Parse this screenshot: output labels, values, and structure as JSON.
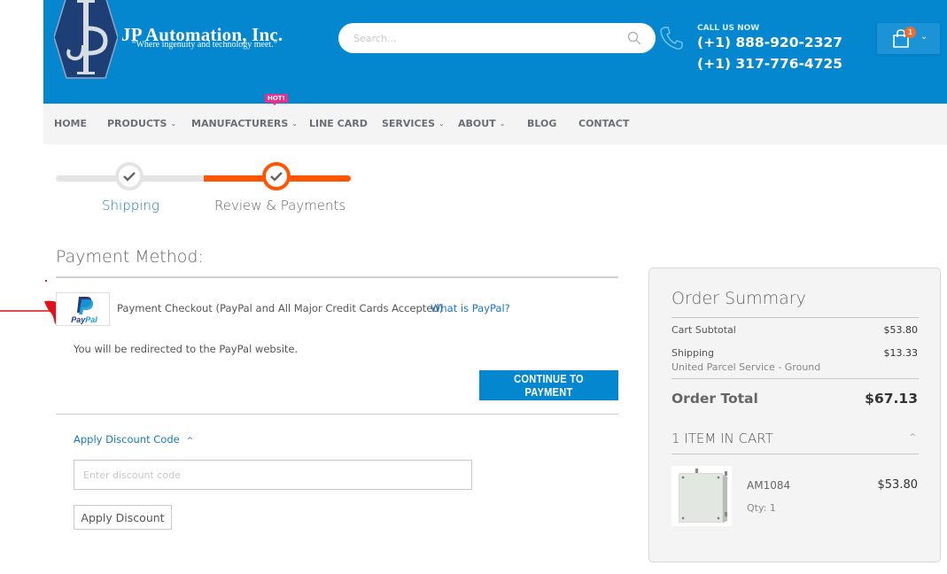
{
  "header": {
    "logo_monogram": "JP",
    "company_name": "JP Automation, Inc.",
    "tagline": "“Where ingenuity and technology meet.”",
    "search_placeholder": "Search...",
    "search_icon": "search-icon",
    "phone_icon": "phone-icon",
    "call_label": "CALL US NOW",
    "phone_primary": "(+1) 888-920-2327",
    "phone_secondary": "(+1) 317-776-4725",
    "cart_icon": "shopping-bag-icon",
    "cart_count": "1",
    "colors": {
      "primary": "#0487cf",
      "badge": "#f26a2e"
    }
  },
  "nav": {
    "items": [
      {
        "label": "HOME",
        "has_dropdown": false
      },
      {
        "label": "PRODUCTS",
        "has_dropdown": true
      },
      {
        "label": "MANUFACTURERS",
        "has_dropdown": true,
        "badge": "HOT!"
      },
      {
        "label": "LINE CARD",
        "has_dropdown": false
      },
      {
        "label": "SERVICES",
        "has_dropdown": true
      },
      {
        "label": "ABOUT",
        "has_dropdown": true
      },
      {
        "label": "BLOG",
        "has_dropdown": false
      },
      {
        "label": "CONTACT",
        "has_dropdown": false
      }
    ],
    "dropdown_glyph": "⌄",
    "badge_color": "#e8308a"
  },
  "progress": {
    "steps": [
      {
        "label": "Shipping",
        "state": "complete"
      },
      {
        "label": "Review & Payments",
        "state": "active"
      }
    ],
    "active_color": "#ff5501"
  },
  "payment": {
    "title": "Payment Method:",
    "method_label": "Payment Checkout (PayPal and All Major Credit Cards Accepted)",
    "method_logo_text": "PayPal",
    "what_is_link": "What is PayPal?",
    "redirect_note": "You will be redirected to the PayPal website.",
    "continue_button": "CONTINUE TO PAYMENT"
  },
  "discount": {
    "toggle_label": "Apply Discount Code",
    "toggle_glyph": "^",
    "input_placeholder": "Enter discount code",
    "input_value": "",
    "apply_button": "Apply Discount"
  },
  "summary": {
    "title": "Order Summary",
    "subtotal_label": "Cart Subtotal",
    "subtotal_value": "$53.80",
    "shipping_label": "Shipping",
    "shipping_method": "United Parcel Service - Ground",
    "shipping_value": "$13.33",
    "total_label": "Order Total",
    "total_value": "$67.13",
    "items_header": "1 ITEM IN CART",
    "items_toggle_glyph": "^",
    "items": [
      {
        "name": "AM1084",
        "qty_label": "Qty: 1",
        "price": "$53.80"
      }
    ]
  }
}
